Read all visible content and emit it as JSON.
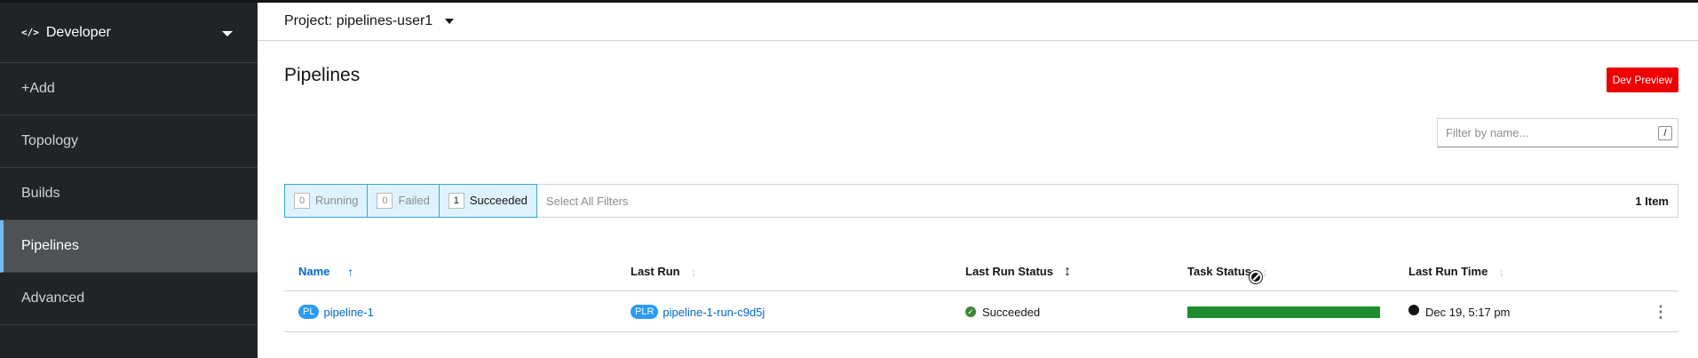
{
  "sidebar": {
    "perspective": {
      "icon": "code-icon",
      "label": "Developer"
    },
    "items": [
      {
        "label": "+Add",
        "active": false
      },
      {
        "label": "Topology",
        "active": false
      },
      {
        "label": "Builds",
        "active": false
      },
      {
        "label": "Pipelines",
        "active": true
      },
      {
        "label": "Advanced",
        "active": false
      }
    ]
  },
  "header": {
    "project_label": "Project: pipelines-user1"
  },
  "page": {
    "title": "Pipelines",
    "dev_preview": "Dev Preview",
    "filter_placeholder": "Filter by name...",
    "filter_shortcut": "/"
  },
  "row_filters": {
    "chips": [
      {
        "count": "0",
        "label": "Running"
      },
      {
        "count": "0",
        "label": "Failed"
      },
      {
        "count": "1",
        "label": "Succeeded"
      }
    ],
    "select_all": "Select All Filters",
    "item_count": "1 Item"
  },
  "table": {
    "columns": [
      "Name",
      "Last Run",
      "Last Run Status",
      "Task Status",
      "Last Run Time"
    ],
    "rows": [
      {
        "name_badge": "PL",
        "name": "pipeline-1",
        "last_run_badge": "PLR",
        "last_run": "pipeline-1-run-c9d5j",
        "status": "Succeeded",
        "task_status_fraction": 1.0,
        "last_run_time": "Dec 19, 5:17 pm"
      }
    ]
  },
  "colors": {
    "accent": "#0066cc",
    "success": "#1e8d2e",
    "dev_preview": "#ee0000",
    "badge": "#2b9af3"
  }
}
